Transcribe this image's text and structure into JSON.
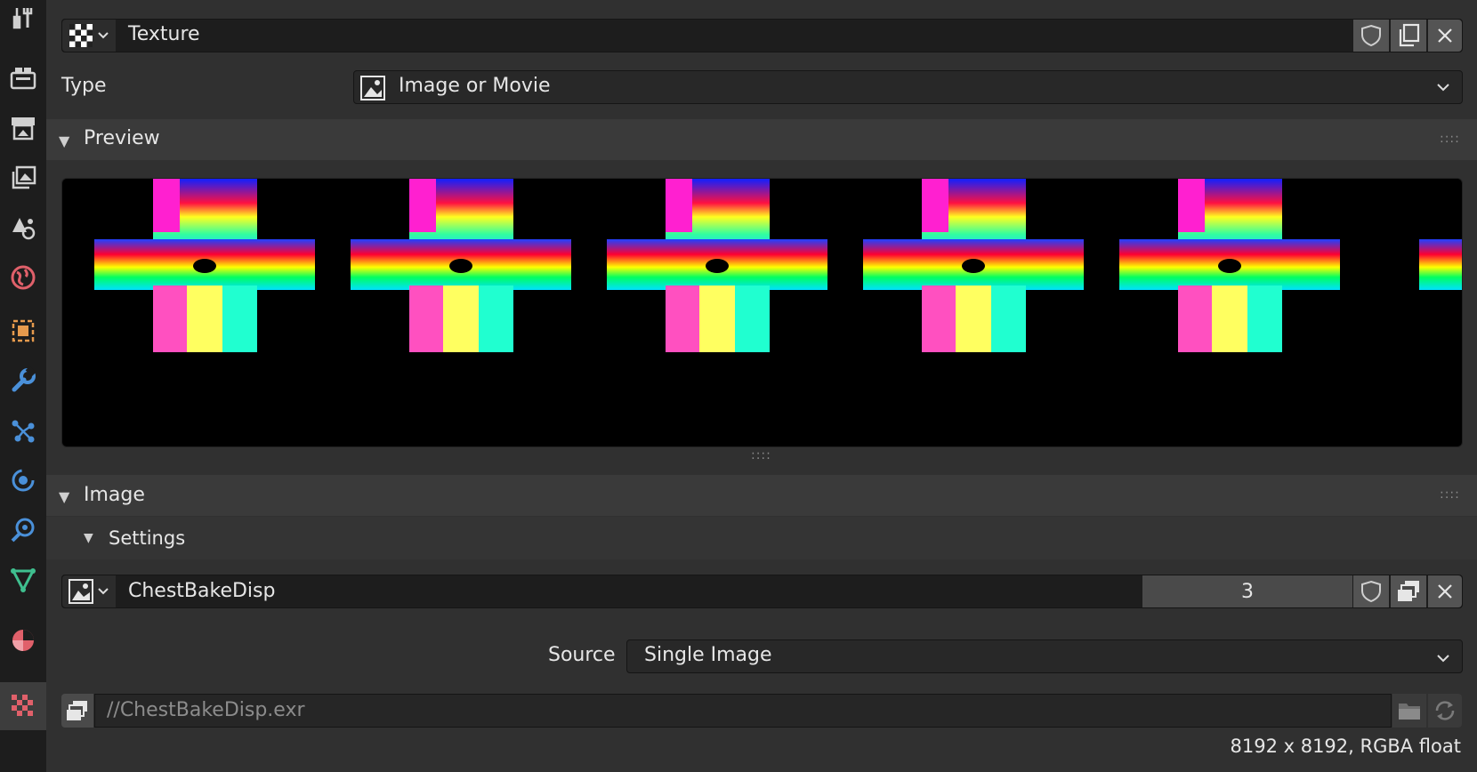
{
  "texture_block": {
    "name": "Texture",
    "type_label": "Type",
    "type_value": "Image or Movie"
  },
  "preview_panel": {
    "title": "Preview"
  },
  "image_panel": {
    "title": "Image",
    "settings_title": "Settings",
    "image_name": "ChestBakeDisp",
    "users": "3",
    "source_label": "Source",
    "source_value": "Single Image",
    "filepath": "//ChestBakeDisp.exr",
    "info": "8192 x 8192,  RGBA float"
  },
  "sidebar": {
    "tabs": [
      "tool-icon",
      "render-icon",
      "output-icon",
      "view-layer-icon",
      "scene-icon",
      "world-icon",
      "object-icon",
      "modifier-icon",
      "particles-icon",
      "physics-icon",
      "constraints-icon",
      "data-icon",
      "material-icon",
      "texture-icon"
    ]
  },
  "colors": {
    "background": "#303030",
    "field": "#1d1d1d",
    "sidebar": "#1d1d1d",
    "accent_blue": "#4a90d9",
    "accent_orange": "#e69a4d",
    "accent_green": "#3fbf8f",
    "accent_red": "#e0606a"
  }
}
